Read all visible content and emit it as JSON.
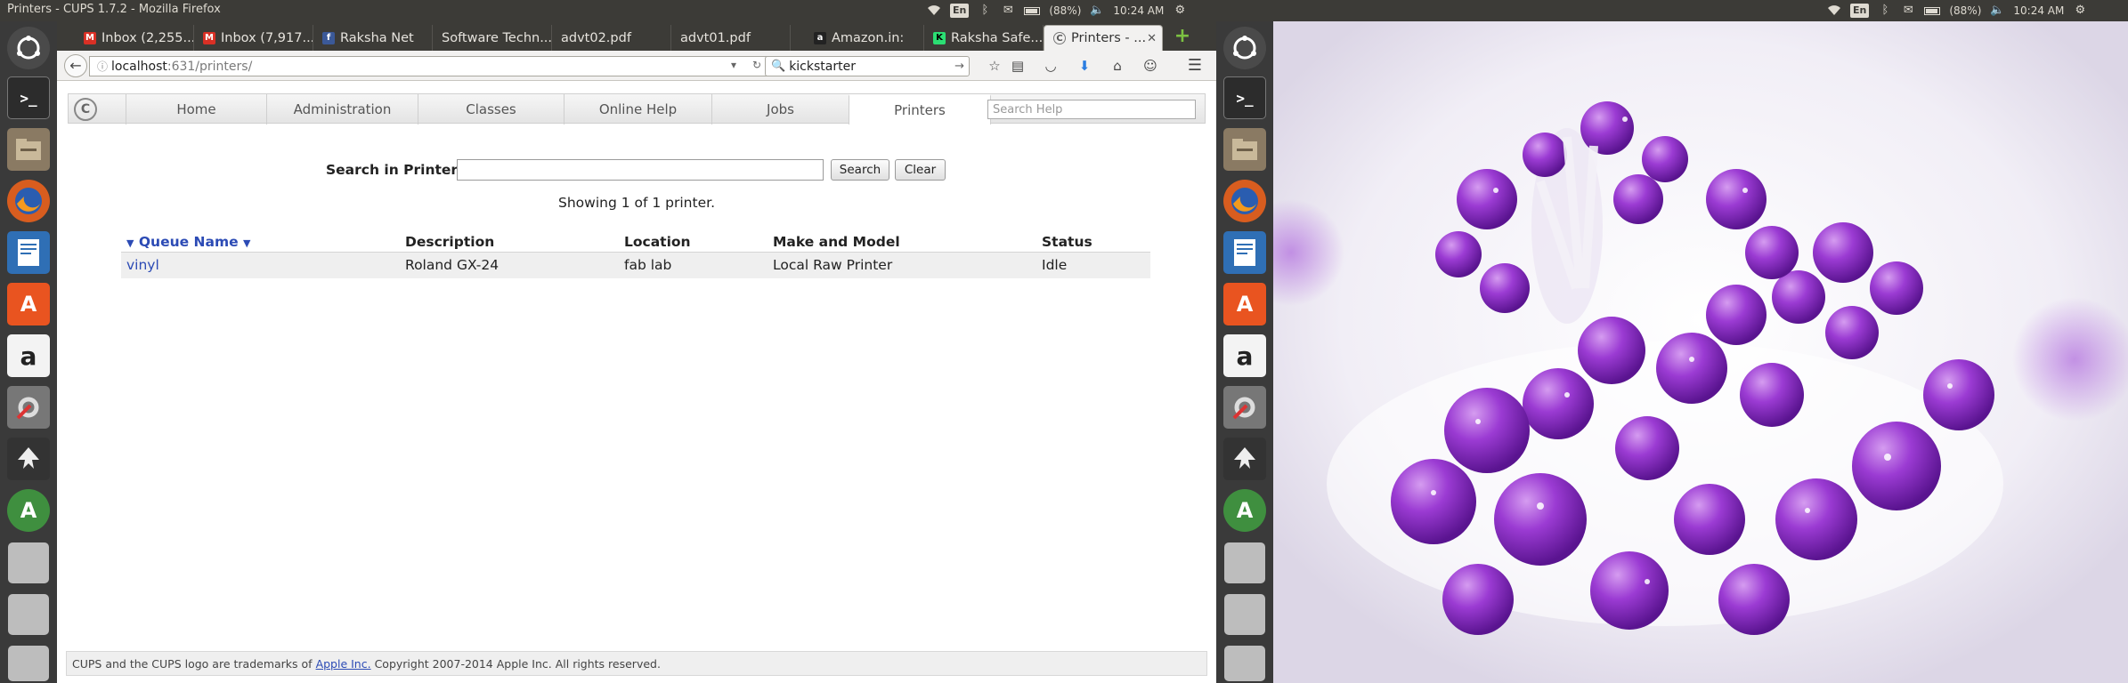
{
  "left": {
    "window_title": "Printers - CUPS 1.7.2 - Mozilla Firefox",
    "indicators": {
      "lang": "En",
      "battery": "(88%)",
      "clock": "10:24 AM"
    },
    "tabs": [
      {
        "label": "Inbox (2,255...",
        "icon": "gmail-icon",
        "color": "#d93025"
      },
      {
        "label": "Inbox (7,917...",
        "icon": "gmail-icon",
        "color": "#d93025"
      },
      {
        "label": "Raksha Net",
        "icon": "facebook-icon",
        "color": "#3b5998"
      },
      {
        "label": "Software Techn...",
        "icon": "blank-page-icon",
        "color": ""
      },
      {
        "label": "advt02.pdf",
        "icon": "blank-page-icon",
        "color": ""
      },
      {
        "label": "advt01.pdf",
        "icon": "blank-page-icon",
        "color": ""
      },
      {
        "label": "Amazon.in:",
        "icon": "amazon-icon",
        "color": "#222222"
      },
      {
        "label": "Raksha Safe...",
        "icon": "kickstarter-icon",
        "color": "#2bde73"
      },
      {
        "label": "Printers - ...",
        "icon": "cups-icon",
        "color": "#888888",
        "active": true
      }
    ],
    "url": {
      "host": "localhost",
      "path": ":631/printers/"
    },
    "search_value": "kickstarter",
    "cups_nav": [
      "Home",
      "Administration",
      "Classes",
      "Online Help",
      "Jobs",
      "Printers"
    ],
    "cups_search_placeholder": "Search Help",
    "search_label": "Search in Printers:",
    "search_button": "Search",
    "clear_button": "Clear",
    "showing": "Showing 1 of 1 printer.",
    "table": {
      "headers": [
        "Queue Name",
        "Description",
        "Location",
        "Make and Model",
        "Status"
      ],
      "rows": [
        [
          "vinyl",
          "Roland GX-24",
          "fab lab",
          "Local Raw Printer",
          "Idle"
        ]
      ]
    },
    "footer": {
      "before": "CUPS and the CUPS logo are trademarks of",
      "link": "Apple Inc.",
      "after": "Copyright 2007-2014 Apple Inc. All rights reserved."
    }
  },
  "right": {
    "indicators": {
      "lang": "En",
      "battery": "(88%)",
      "clock": "10:24 AM"
    }
  }
}
